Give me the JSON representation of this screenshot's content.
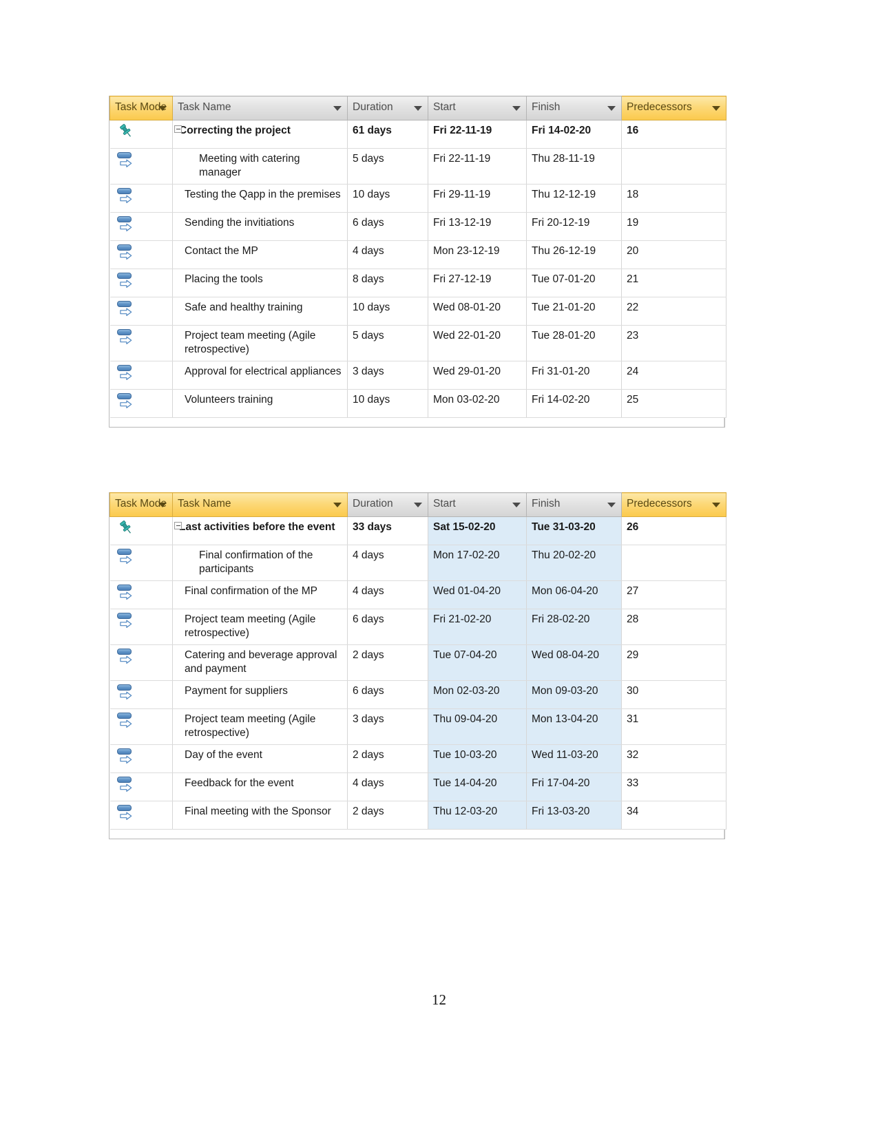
{
  "document": {
    "page_number": "12"
  },
  "columns": {
    "task_mode": "Task Mode",
    "task_name": "Task Name",
    "duration": "Duration",
    "start": "Start",
    "finish": "Finish",
    "predecessors": "Predecessors"
  },
  "tables": [
    {
      "id": "gantt-table-1",
      "highlighted_header": "predecessors",
      "rows": [
        {
          "mode_icon": "pin-icon",
          "name": "Correcting the project",
          "duration": "61 days",
          "start": "Fri 22-11-19",
          "finish": "Fri 14-02-20",
          "predecessors": "16",
          "summary": true,
          "expander": true,
          "indent": 0
        },
        {
          "mode_icon": "auto-schedule-icon",
          "name": "Meeting with catering manager",
          "duration": "5 days",
          "start": "Fri 22-11-19",
          "finish": "Thu 28-11-19",
          "predecessors": "",
          "summary": false,
          "expander": false,
          "indent": 2
        },
        {
          "mode_icon": "auto-schedule-icon",
          "name": "Testing the Qapp in the premises",
          "duration": "10 days",
          "start": "Fri 29-11-19",
          "finish": "Thu 12-12-19",
          "predecessors": "18",
          "summary": false,
          "expander": false,
          "indent": 1
        },
        {
          "mode_icon": "auto-schedule-icon",
          "name": "Sending  the invitiations",
          "duration": "6 days",
          "start": "Fri 13-12-19",
          "finish": "Fri 20-12-19",
          "predecessors": "19",
          "summary": false,
          "expander": false,
          "indent": 1
        },
        {
          "mode_icon": "auto-schedule-icon",
          "name": "Contact the MP",
          "duration": "4 days",
          "start": "Mon 23-12-19",
          "finish": "Thu 26-12-19",
          "predecessors": "20",
          "summary": false,
          "expander": false,
          "indent": 1
        },
        {
          "mode_icon": "auto-schedule-icon",
          "name": "Placing the tools",
          "duration": "8 days",
          "start": "Fri 27-12-19",
          "finish": "Tue 07-01-20",
          "predecessors": "21",
          "summary": false,
          "expander": false,
          "indent": 1
        },
        {
          "mode_icon": "auto-schedule-icon",
          "name": "Safe and healthy training",
          "duration": "10 days",
          "start": "Wed 08-01-20",
          "finish": "Tue 21-01-20",
          "predecessors": "22",
          "summary": false,
          "expander": false,
          "indent": 1
        },
        {
          "mode_icon": "auto-schedule-icon",
          "name": "Project team meeting (Agile retrospective)",
          "duration": "5 days",
          "start": "Wed 22-01-20",
          "finish": "Tue 28-01-20",
          "predecessors": "23",
          "summary": false,
          "expander": false,
          "indent": 1
        },
        {
          "mode_icon": "auto-schedule-icon",
          "name": "Approval for electrical appliances",
          "duration": "3 days",
          "start": "Wed 29-01-20",
          "finish": "Fri 31-01-20",
          "predecessors": "24",
          "summary": false,
          "expander": false,
          "indent": 1
        },
        {
          "mode_icon": "auto-schedule-icon",
          "name": "Volunteers training",
          "duration": "10 days",
          "start": "Mon 03-02-20",
          "finish": "Fri 14-02-20",
          "predecessors": "25",
          "summary": false,
          "expander": false,
          "indent": 1
        }
      ]
    },
    {
      "id": "gantt-table-2",
      "highlighted_header": "task_name_and_predecessors",
      "rows": [
        {
          "mode_icon": "pin-icon",
          "name": "Last activities before the event",
          "duration": "33 days",
          "start": "Sat 15-02-20",
          "finish": "Tue 31-03-20",
          "predecessors": "26",
          "summary": true,
          "expander": true,
          "indent": 0
        },
        {
          "mode_icon": "auto-schedule-icon",
          "name": "Final confirmation of the participants",
          "duration": "4 days",
          "start": "Mon 17-02-20",
          "finish": "Thu 20-02-20",
          "predecessors": "",
          "summary": false,
          "expander": false,
          "indent": 2
        },
        {
          "mode_icon": "auto-schedule-icon",
          "name": "Final confirmation of the MP",
          "duration": "4 days",
          "start": "Wed 01-04-20",
          "finish": "Mon 06-04-20",
          "predecessors": "27",
          "summary": false,
          "expander": false,
          "indent": 1
        },
        {
          "mode_icon": "auto-schedule-icon",
          "name": "Project team meeting (Agile retrospective)",
          "duration": "6 days",
          "start": "Fri 21-02-20",
          "finish": "Fri 28-02-20",
          "predecessors": "28",
          "summary": false,
          "expander": false,
          "indent": 1
        },
        {
          "mode_icon": "auto-schedule-icon",
          "name": "Catering and beverage approval and payment",
          "duration": "2 days",
          "start": "Tue 07-04-20",
          "finish": "Wed 08-04-20",
          "predecessors": "29",
          "summary": false,
          "expander": false,
          "indent": 1
        },
        {
          "mode_icon": "auto-schedule-icon",
          "name": "Payment for suppliers",
          "duration": "6 days",
          "start": "Mon 02-03-20",
          "finish": "Mon 09-03-20",
          "predecessors": "30",
          "summary": false,
          "expander": false,
          "indent": 1
        },
        {
          "mode_icon": "auto-schedule-icon",
          "name": "Project team meeting (Agile retrospective)",
          "duration": "3 days",
          "start": "Thu 09-04-20",
          "finish": "Mon 13-04-20",
          "predecessors": "31",
          "summary": false,
          "expander": false,
          "indent": 1
        },
        {
          "mode_icon": "auto-schedule-icon",
          "name": "Day of the event",
          "duration": "2 days",
          "start": "Tue 10-03-20",
          "finish": "Wed 11-03-20",
          "predecessors": "32",
          "summary": false,
          "expander": false,
          "indent": 1
        },
        {
          "mode_icon": "auto-schedule-icon",
          "name": "Feedback for the event",
          "duration": "4 days",
          "start": "Tue 14-04-20",
          "finish": "Fri 17-04-20",
          "predecessors": "33",
          "summary": false,
          "expander": false,
          "indent": 1
        },
        {
          "mode_icon": "auto-schedule-icon",
          "name": "Final meeting with the Sponsor",
          "duration": "2 days",
          "start": "Thu 12-03-20",
          "finish": "Fri 13-03-20",
          "predecessors": "34",
          "summary": false,
          "expander": false,
          "indent": 1
        }
      ]
    }
  ],
  "colors": {
    "header_highlight": "#fbc94c",
    "header_default": "#d4d4d4",
    "selection_tint": "#dcebf7",
    "pin_icon": "#2f9e9b",
    "auto_icon": "#5e92c6"
  }
}
